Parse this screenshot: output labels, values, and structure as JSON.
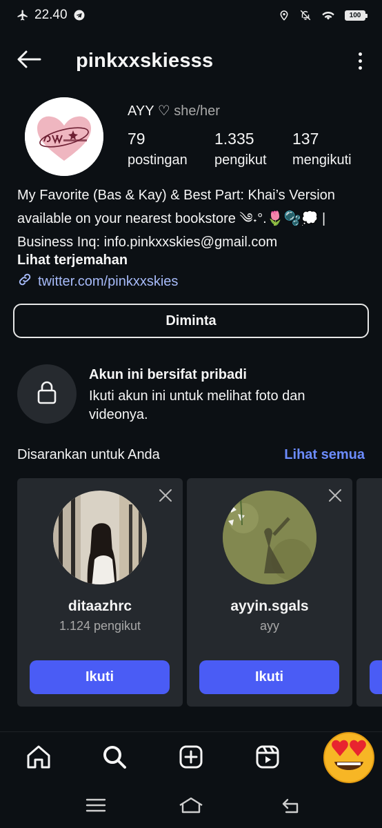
{
  "status_bar": {
    "time": "22.40",
    "battery": "100"
  },
  "header": {
    "username": "pinkxxskiesss"
  },
  "profile": {
    "display_name": "AYY ♡",
    "pronouns": "she/her",
    "stats": [
      {
        "value": "79",
        "label": "postingan"
      },
      {
        "value": "1.335",
        "label": "pengikut"
      },
      {
        "value": "137",
        "label": "mengikuti"
      }
    ],
    "bio_lines": [
      "My Favorite (Bas & Kay) & Best Part: Khai’s Version",
      "available on your nearest bookstore ༄˖°.🌷🫧💭 |",
      "Business Inq: info.pinkxxskies@gmail.com"
    ],
    "translate_label": "Lihat terjemahan",
    "link": "twitter.com/pinkxxskies",
    "requested_label": "Diminta"
  },
  "private": {
    "title": "Akun ini bersifat pribadi",
    "description": "Ikuti akun ini untuk melihat foto dan videonya."
  },
  "suggestions": {
    "heading": "Disarankan untuk Anda",
    "see_all": "Lihat semua",
    "cards": [
      {
        "name": "ditaazhrc",
        "subtitle": "1.124 pengikut",
        "button": "Ikuti"
      },
      {
        "name": "ayyin.sgals",
        "subtitle": "ayy",
        "button": "Ikuti"
      }
    ]
  },
  "bottom_nav": {
    "items": [
      "home-icon",
      "search-icon",
      "create-post-icon",
      "reels-icon",
      "profile-emoji-avatar"
    ]
  },
  "colors": {
    "background": "#0c1014",
    "card": "#25292e",
    "accent": "#4a5cf5",
    "link": "#a7bbf9",
    "see_all": "#6c8cff"
  }
}
